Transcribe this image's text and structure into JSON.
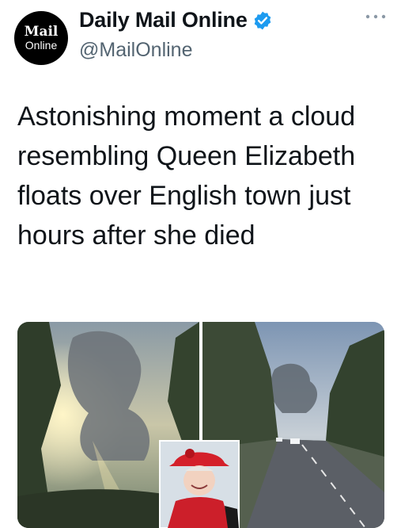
{
  "account": {
    "avatar_line1": "Mail",
    "avatar_line2": "Online",
    "display_name": "Daily Mail Online",
    "handle": "@MailOnline",
    "verified": true
  },
  "tweet": {
    "text": "Astonishing moment a cloud resembling Queen Elizabeth floats over English town just hours after she died"
  },
  "media": {
    "images": [
      {
        "name": "cloud-photo",
        "description_icon": "image-icon"
      },
      {
        "name": "road-photo",
        "description_icon": "image-icon"
      },
      {
        "name": "queen-inset-photo",
        "description_icon": "image-icon"
      }
    ]
  },
  "colors": {
    "verified_blue": "#1d9bf0",
    "handle_grey": "#536471",
    "text_black": "#0f1419"
  }
}
